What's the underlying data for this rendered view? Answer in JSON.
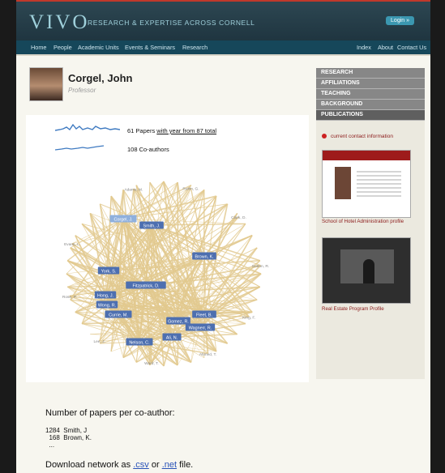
{
  "header": {
    "logo": "VIVO",
    "tagline": "RESEARCH & EXPERTISE ACROSS CORNELL",
    "login_label": "Login »"
  },
  "nav": {
    "items": [
      "Home",
      "People",
      "Academic Units",
      "Events & Seminars",
      "Research"
    ],
    "right_items": [
      "Index",
      "About",
      "Contact Us"
    ]
  },
  "profile": {
    "name": "Corgel, John",
    "title": "Professor"
  },
  "stats": {
    "papers_prefix": "61 Papers ",
    "papers_link": "with year from 87 total",
    "coauthors": "108 Co-authors"
  },
  "network": {
    "nodes": [
      "Corgel, J.",
      "Smith, J.",
      "Brown, K.",
      "York, S.",
      "Fitzpatrick, D.",
      "Hong, J.",
      "Wong, R.",
      "Currie, M.",
      "Fleet, B.",
      "Gomez, R.",
      "Wagnerr, R.",
      "Ali, N.",
      "Nelson, C.",
      "Adams, M.",
      "Rubin, G.",
      "Clark, D.",
      "Sutton, R.",
      "King, F.",
      "Ahmed, T.",
      "Ward, T.",
      "Lee, J.",
      "Rose, P.",
      "Evans, L."
    ]
  },
  "coauthor_counts": {
    "heading": "Number of papers per co-author:",
    "rows": [
      "1284  Smith, J",
      "  168  Brown, K.",
      "  ..."
    ]
  },
  "download": {
    "prefix": "Download network as ",
    "csv": ".csv",
    "or": " or ",
    "net": ".net",
    "suffix": " file."
  },
  "sidebar": {
    "menu": [
      "RESEARCH",
      "AFFILIATIONS",
      "TEACHING",
      "BACKGROUND",
      "PUBLICATIONS"
    ],
    "contact_link": "current contact information",
    "caption1": "School of Hotel Administration profile",
    "caption2": "Real Estate Program Profile"
  },
  "colors": {
    "header": "#1f3540",
    "nav": "#16475a",
    "logo": "#9fd0db",
    "edge": "#e2c98e",
    "node": "#4d6fb0",
    "spark": "#3e7ac1",
    "link_red": "#8b1a1a"
  }
}
